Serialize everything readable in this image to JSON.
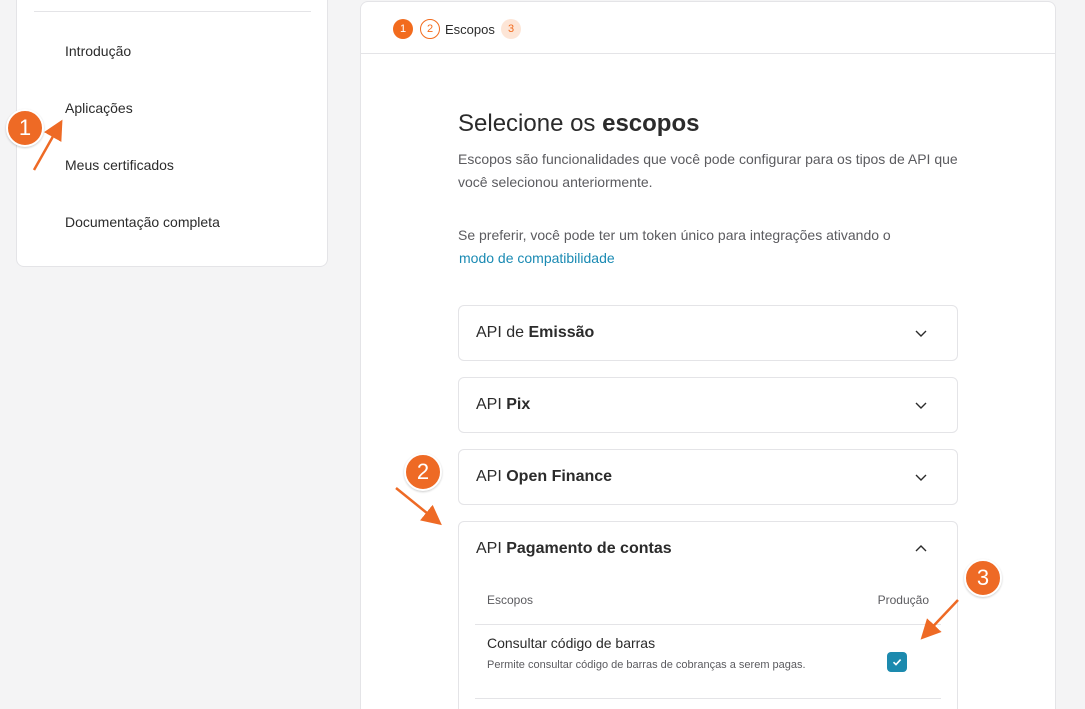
{
  "sidebar": {
    "items": [
      {
        "label": "Introdução"
      },
      {
        "label": "Aplicações"
      },
      {
        "label": "Meus certificados"
      },
      {
        "label": "Documentação completa"
      }
    ]
  },
  "stepper": {
    "steps": [
      {
        "number": "1",
        "state": "done"
      },
      {
        "number": "2",
        "state": "current",
        "label": "Escopos"
      },
      {
        "number": "3",
        "state": "next"
      }
    ]
  },
  "main": {
    "title_light": "Selecione os ",
    "title_bold": "escopos",
    "description": "Escopos são funcionalidades que você pode configurar para os tipos de API que você selecionou anteriormente.",
    "compat_text": "Se preferir, você pode ter um token único para integrações ativando o",
    "compat_link": "modo de compatibilidade"
  },
  "apis": [
    {
      "prefix": "API de ",
      "name": "Emissão",
      "expanded": false
    },
    {
      "prefix": "API ",
      "name": "Pix",
      "expanded": false
    },
    {
      "prefix": "API ",
      "name": "Open Finance",
      "expanded": false
    },
    {
      "prefix": "API ",
      "name": "Pagamento de contas",
      "expanded": true
    }
  ],
  "scopes_table": {
    "col_scopes": "Escopos",
    "col_production": "Produção",
    "rows": [
      {
        "name": "Consultar código de barras",
        "description": "Permite consultar código de barras de cobranças a serem pagas.",
        "production_checked": true
      }
    ]
  },
  "annotations": [
    {
      "number": "1"
    },
    {
      "number": "2"
    },
    {
      "number": "3"
    }
  ],
  "colors": {
    "accent_orange": "#f26b1d",
    "checkbox_teal": "#1c8aae",
    "link_blue": "#1a8ab3"
  }
}
